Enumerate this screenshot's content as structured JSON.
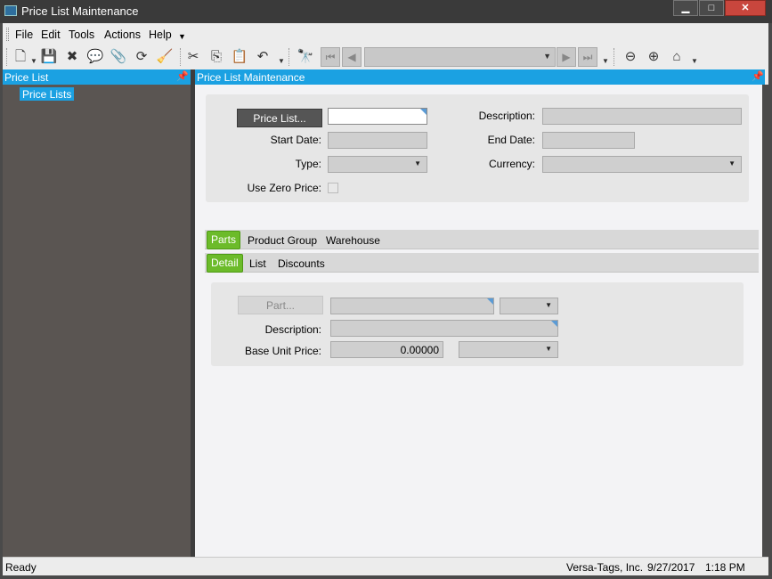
{
  "window": {
    "title": "Price List Maintenance",
    "icon": "window-app-icon",
    "controls": {
      "minimize": "▁",
      "maximize": "□",
      "close": "✕"
    }
  },
  "menubar": {
    "items": [
      "File",
      "Edit",
      "Tools",
      "Actions",
      "Help"
    ]
  },
  "toolbar": {
    "icons": [
      "new-icon",
      "save-icon",
      "delete-icon",
      "comment-icon",
      "attach-icon",
      "refresh-icon",
      "clear-icon",
      "cut-icon",
      "copy-icon",
      "paste-icon",
      "undo-icon",
      "search-binoculars-icon",
      "first-record-icon",
      "prev-record-icon",
      "next-record-icon",
      "last-record-icon",
      "back-icon",
      "forward-icon",
      "home-icon"
    ],
    "navigator_value": ""
  },
  "left_panel": {
    "title": "Price List",
    "tree": [
      "Price Lists"
    ]
  },
  "right_panel": {
    "title": "Price List Maintenance",
    "header_group": {
      "price_list_button": "Price List...",
      "price_list_value": "",
      "description_label": "Description:",
      "description_value": "",
      "start_date_label": "Start Date:",
      "start_date_value": "",
      "end_date_label": "End Date:",
      "end_date_value": "",
      "type_label": "Type:",
      "type_value": "",
      "currency_label": "Currency:",
      "currency_value": "",
      "use_zero_price_label": "Use Zero Price:",
      "use_zero_price_checked": false
    },
    "tabs_top": [
      "Parts",
      "Product Group",
      "Warehouse"
    ],
    "tabs_top_active": "Parts",
    "tabs_sub": [
      "Detail",
      "List",
      "Discounts"
    ],
    "tabs_sub_active": "Detail",
    "detail_group": {
      "part_button": "Part...",
      "part_value": "",
      "part_rev_value": "",
      "description_label": "Description:",
      "description_value": "",
      "base_unit_price_label": "Base Unit Price:",
      "base_unit_price_value": "0.00000",
      "uom_value": ""
    }
  },
  "statusbar": {
    "status": "Ready",
    "company": "Versa-Tags, Inc.",
    "date": "9/27/2017",
    "time": "1:18 PM"
  },
  "colors": {
    "accent_blue": "#1ba1e2",
    "tab_green": "#6cbb2a",
    "dark_panel": "#5a5552"
  }
}
